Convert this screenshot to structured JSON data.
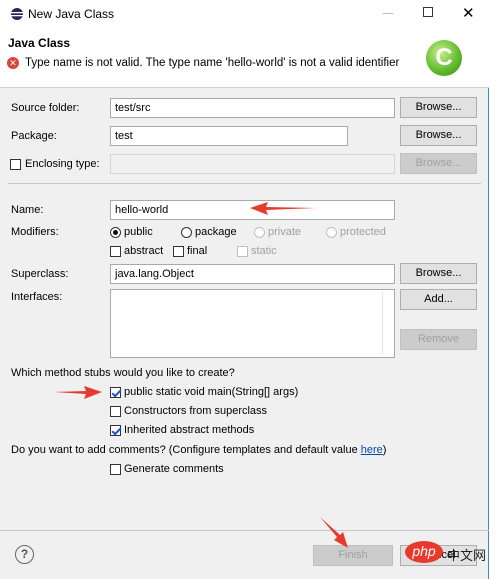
{
  "window": {
    "title": "New Java Class"
  },
  "header": {
    "title": "Java Class",
    "error": "Type name is not valid. The type name 'hello-world' is not a valid identifier",
    "colors": {
      "error": "#d9463a",
      "logo": "#5cb82b"
    }
  },
  "form": {
    "source_folder": {
      "label": "Source folder:",
      "value": "test/src",
      "button": "Browse..."
    },
    "package": {
      "label": "Package:",
      "value": "test",
      "button": "Browse..."
    },
    "enclosing_type": {
      "label": "Enclosing type:",
      "value": "",
      "button": "Browse...",
      "checked": false
    },
    "name": {
      "label": "Name:",
      "value": "hello-world"
    },
    "modifiers": {
      "label": "Modifiers:",
      "access": [
        {
          "label": "public",
          "selected": true,
          "enabled": true
        },
        {
          "label": "package",
          "selected": false,
          "enabled": true
        },
        {
          "label": "private",
          "selected": false,
          "enabled": false
        },
        {
          "label": "protected",
          "selected": false,
          "enabled": false
        }
      ],
      "flags": [
        {
          "label": "abstract",
          "checked": false,
          "enabled": true
        },
        {
          "label": "final",
          "checked": false,
          "enabled": true
        },
        {
          "label": "static",
          "checked": false,
          "enabled": false
        }
      ]
    },
    "superclass": {
      "label": "Superclass:",
      "value": "java.lang.Object",
      "button": "Browse..."
    },
    "interfaces": {
      "label": "Interfaces:",
      "add": "Add...",
      "remove": "Remove"
    },
    "stubs": {
      "question": "Which method stubs would you like to create?",
      "items": [
        {
          "label": "public static void main(String[] args)",
          "checked": true
        },
        {
          "label": "Constructors from superclass",
          "checked": false
        },
        {
          "label": "Inherited abstract methods",
          "checked": true
        }
      ]
    },
    "comments": {
      "question_pre": "Do you want to add comments? (Configure templates and default value ",
      "link": "here",
      "question_post": ")",
      "generate": "Generate comments",
      "checked": false
    }
  },
  "footer": {
    "finish": "Finish",
    "cancel": "Cancel"
  },
  "watermark": {
    "text": "php中文网"
  }
}
